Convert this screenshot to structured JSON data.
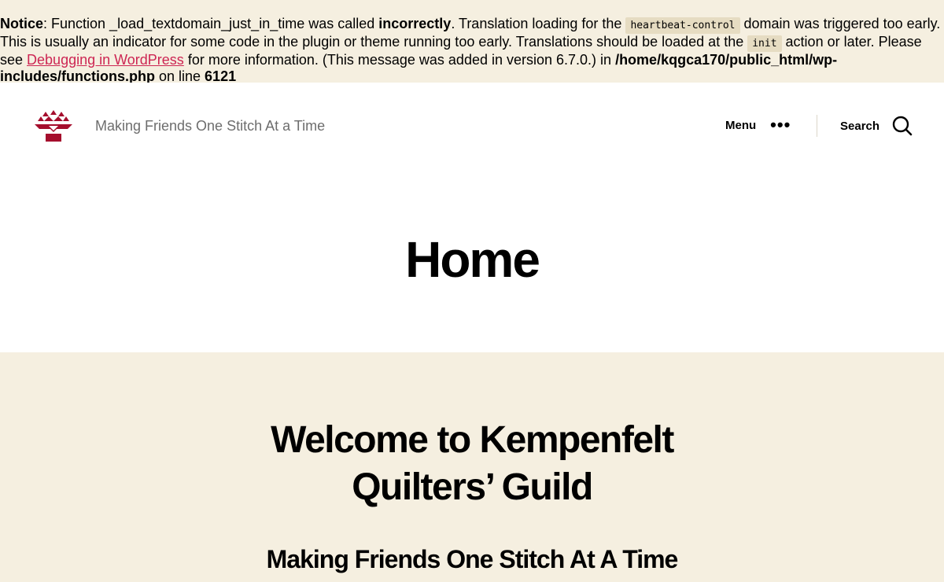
{
  "notice": {
    "label": "Notice",
    "text1": ": Function _load_textdomain_just_in_time was called ",
    "bold1": "incorrectly",
    "text2": ". Translation loading for the ",
    "code1": "heartbeat-control",
    "text3": " domain was triggered too early. This is usually an indicator for some code in the plugin or theme running too early. Translations should be loaded at the ",
    "code2": "init",
    "text4": " action or later. Please see ",
    "link": "Debugging in WordPress",
    "text5": " for more information. (This message was added in version 6.7.0.) in ",
    "path": "/home/kqgca170/public_html/wp-includes/functions.php",
    "text6": " on line ",
    "line": "6121"
  },
  "header": {
    "tagline": "Making Friends One Stitch At a Time",
    "menu_label": "Menu",
    "search_label": "Search",
    "logo_color": "#a50e2d"
  },
  "page": {
    "title": "Home"
  },
  "content": {
    "heading": "Welcome to Kempenfelt Quilters’ Guild",
    "subheading": "Making Friends One Stitch At A Time"
  }
}
